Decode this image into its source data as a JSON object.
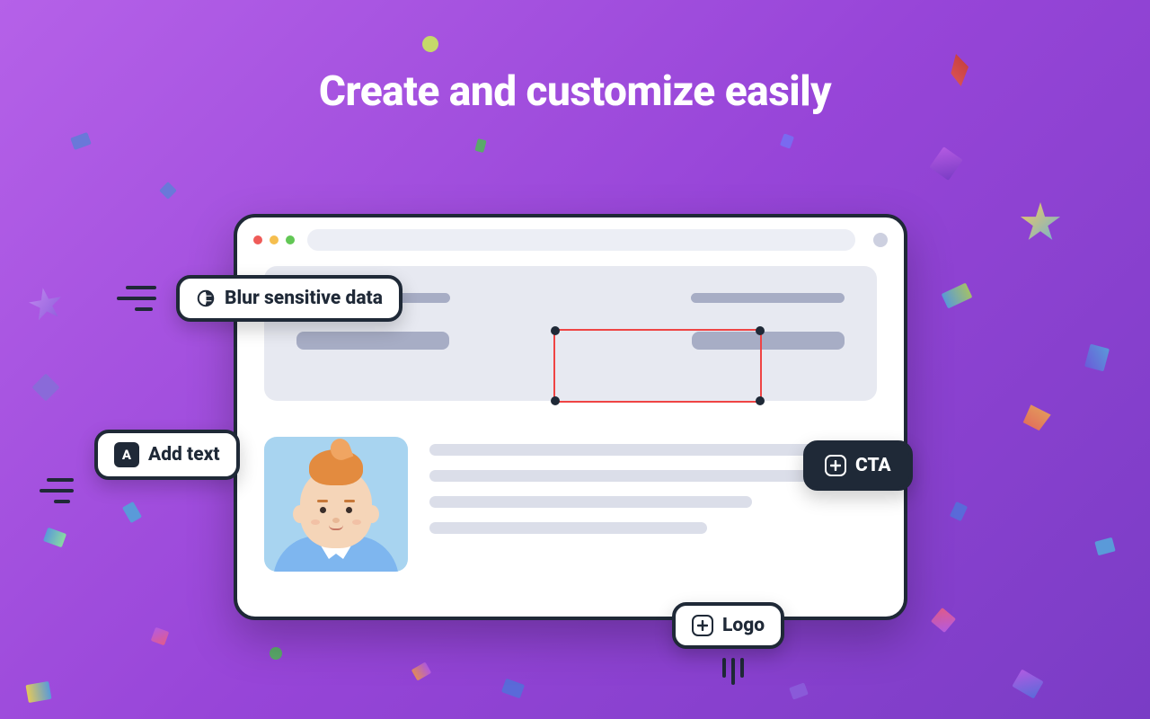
{
  "title": "Create and customize easily",
  "pills": {
    "blur": "Blur sensitive data",
    "add_text": "Add text",
    "cta": "CTA",
    "logo": "Logo"
  },
  "icons": {
    "text_badge": "A"
  }
}
